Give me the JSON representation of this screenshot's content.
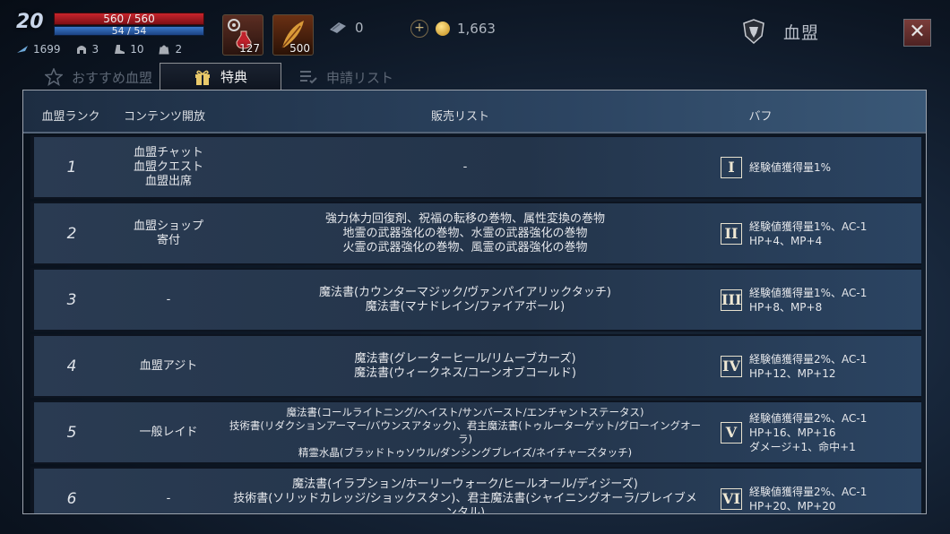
{
  "hud": {
    "level": "20",
    "hp": "560 / 560",
    "mp": "54 / 54",
    "stats": [
      "1699",
      "3",
      "10",
      "2"
    ],
    "items": [
      {
        "icon": "red-potion-icon",
        "count": "127"
      },
      {
        "icon": "feather-scroll-icon",
        "count": "500"
      }
    ],
    "currency1": "0",
    "gold": "1,663",
    "title": "血盟",
    "close": "✕"
  },
  "tabs": [
    {
      "label": "おすすめ血盟",
      "active": false
    },
    {
      "label": "特典",
      "active": true
    },
    {
      "label": "申請リスト",
      "active": false
    }
  ],
  "table": {
    "headers": {
      "rank": "血盟ランク",
      "content": "コンテンツ開放",
      "sales": "販売リスト",
      "buff": "バフ"
    },
    "rows": [
      {
        "rank": "1",
        "content": [
          "血盟チャット",
          "血盟クエスト",
          "血盟出席"
        ],
        "sales": [
          "-"
        ],
        "roman": "I",
        "buff": [
          "経験値獲得量1%"
        ]
      },
      {
        "rank": "2",
        "content": [
          "血盟ショップ",
          "寄付"
        ],
        "sales": [
          "強力体力回復剤、祝福の転移の巻物、属性変換の巻物",
          "地霊の武器強化の巻物、水霊の武器強化の巻物",
          "火霊の武器強化の巻物、風霊の武器強化の巻物"
        ],
        "roman": "II",
        "buff": [
          "経験値獲得量1%、AC-1",
          "HP+4、MP+4"
        ]
      },
      {
        "rank": "3",
        "content": [
          "-"
        ],
        "sales": [
          "魔法書(カウンターマジック/ヴァンパイアリックタッチ)",
          "魔法書(マナドレイン/ファイアボール)"
        ],
        "roman": "III",
        "buff": [
          "経験値獲得量1%、AC-1",
          "HP+8、MP+8"
        ]
      },
      {
        "rank": "4",
        "content": [
          "血盟アジト"
        ],
        "sales": [
          "魔法書(グレーターヒール/リムーブカーズ)",
          "魔法書(ウィークネス/コーンオブコールド)"
        ],
        "roman": "IV",
        "buff": [
          "経験値獲得量2%、AC-1",
          "HP+12、MP+12"
        ]
      },
      {
        "rank": "5",
        "content": [
          "一般レイド"
        ],
        "sales": [
          "魔法書(コールライトニング/ヘイスト/サンバースト/エンチャントステータス)",
          "技術書(リダクションアーマー/バウンスアタック)、君主魔法書(トゥルーターゲット/グローイングオーラ)",
          "精霊水晶(ブラッドトゥソウル/ダンシングブレイズ/ネイチャーズタッチ)"
        ],
        "roman": "V",
        "buff": [
          "経験値獲得量2%、AC-1",
          "HP+16、MP+16",
          "ダメージ+1、命中+1"
        ]
      },
      {
        "rank": "6",
        "content": [
          "-"
        ],
        "sales": [
          "魔法書(イラプション/ホーリーウォーク/ヒールオール/ディジーズ)",
          "技術書(ソリッドカレッジ/ショックスタン)、君主魔法書(シャイニングオーラ/ブレイブメンタル)"
        ],
        "roman": "VI",
        "buff": [
          "経験値獲得量2%、AC-1",
          "HP+20、MP+20"
        ]
      }
    ]
  }
}
